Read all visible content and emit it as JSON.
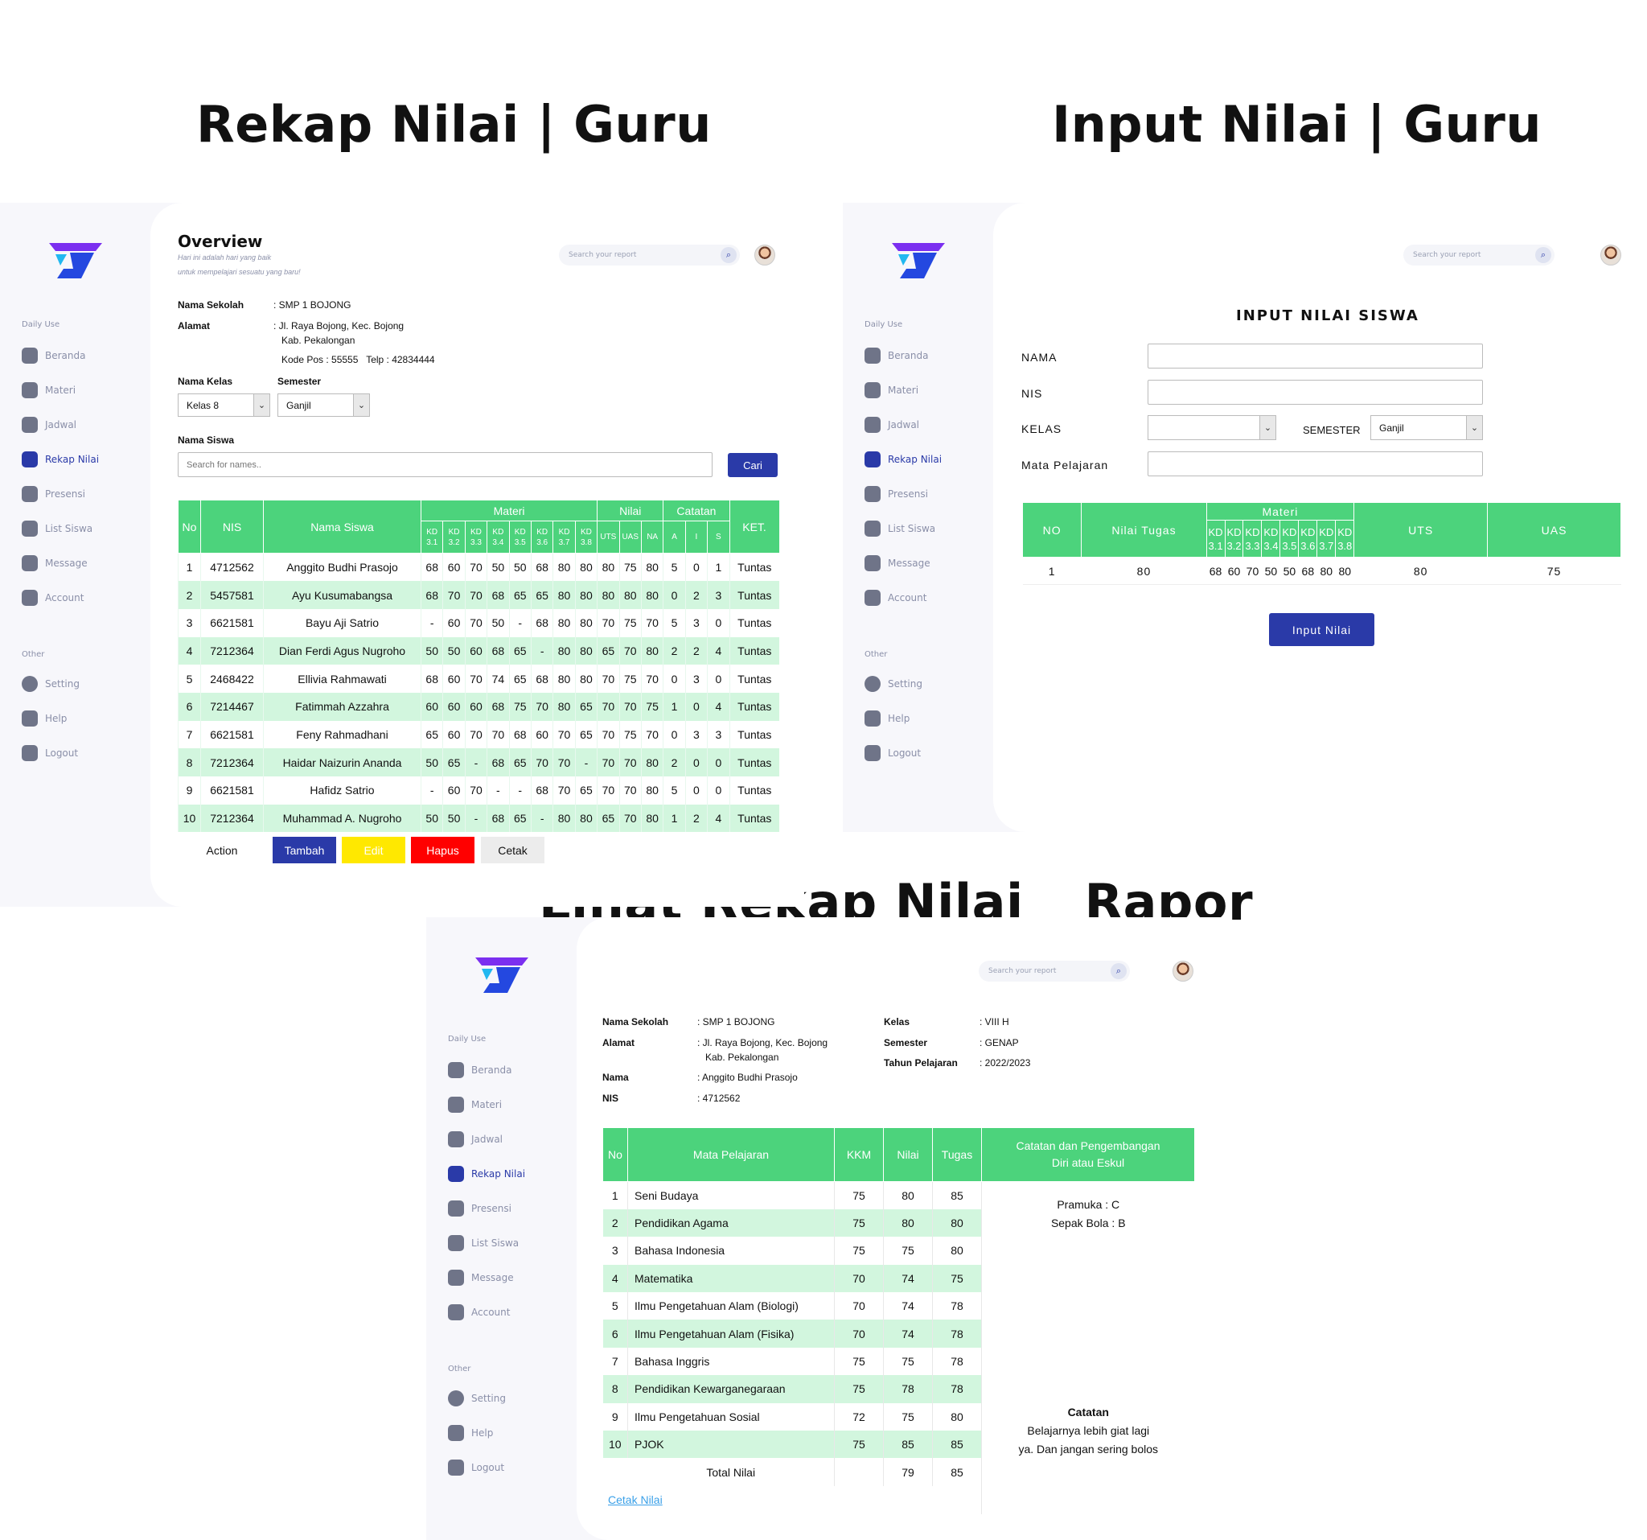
{
  "titles": {
    "rekap": "Rekap Nilai | Guru",
    "input": "Input Nilai | Guru",
    "rapor": "Lihat Rekap Nilai _ Rapor"
  },
  "sidebar": {
    "daily_label": "Daily Use",
    "other_label": "Other",
    "items": [
      "Beranda",
      "Materi",
      "Jadwal",
      "Rekap Nilai",
      "Presensi",
      "List Siswa",
      "Message",
      "Account"
    ],
    "other_items": [
      "Setting",
      "Help",
      "Logout"
    ],
    "active": "Rekap Nilai"
  },
  "search": {
    "placeholder": "Search your report"
  },
  "colors": {
    "green": "#4cd37c",
    "light_green": "#d2f6de",
    "blue": "#2a3aa8",
    "yellow": "#ffe800",
    "red": "#ff0000"
  },
  "rekap": {
    "overview": "Overview",
    "subtitle1": "Hari ini adalah hari yang baik",
    "subtitle2": "untuk mempelajari sesuatu yang baru!",
    "nama_sekolah_label": "Nama Sekolah",
    "nama_sekolah": ": SMP 1 BOJONG",
    "alamat_label": "Alamat",
    "alamat1": ": Jl. Raya Bojong, Kec. Bojong",
    "alamat2": "Kab. Pekalongan",
    "alamat3": "Kode Pos : 55555   Telp : 42834444",
    "nama_kelas_label": "Nama Kelas",
    "semester_label": "Semester",
    "kelas_value": "Kelas 8",
    "semester_value": "Ganjil",
    "nama_siswa_label": "Nama Siswa",
    "search_placeholder": "Search for names..",
    "cari": "Cari",
    "headers": {
      "no": "No",
      "nis": "NIS",
      "nama": "Nama Siswa",
      "materi": "Materi",
      "nilai": "Nilai",
      "catatan": "Catatan",
      "ket": "KET."
    },
    "kd": [
      "KD 3.1",
      "KD 3.2",
      "KD 3.3",
      "KD 3.4",
      "KD 3.5",
      "KD 3.6",
      "KD 3.7",
      "KD 3.8"
    ],
    "nilai_cols": [
      "UTS",
      "UAS",
      "NA"
    ],
    "catatan_cols": [
      "A",
      "I",
      "S"
    ],
    "rows": [
      [
        "1",
        "4712562",
        "Anggito Budhi Prasojo",
        "68",
        "60",
        "70",
        "50",
        "50",
        "68",
        "80",
        "80",
        "80",
        "75",
        "80",
        "5",
        "0",
        "1",
        "Tuntas"
      ],
      [
        "2",
        "5457581",
        "Ayu Kusumabangsa",
        "68",
        "70",
        "70",
        "68",
        "65",
        "65",
        "80",
        "80",
        "80",
        "80",
        "80",
        "0",
        "2",
        "3",
        "Tuntas"
      ],
      [
        "3",
        "6621581",
        "Bayu Aji Satrio",
        "-",
        "60",
        "70",
        "50",
        "-",
        "68",
        "80",
        "80",
        "70",
        "75",
        "70",
        "5",
        "3",
        "0",
        "Tuntas"
      ],
      [
        "4",
        "7212364",
        "Dian Ferdi Agus Nugroho",
        "50",
        "50",
        "60",
        "68",
        "65",
        "-",
        "80",
        "80",
        "65",
        "70",
        "80",
        "2",
        "2",
        "4",
        "Tuntas"
      ],
      [
        "5",
        "2468422",
        "Ellivia Rahmawati",
        "68",
        "60",
        "70",
        "74",
        "65",
        "68",
        "80",
        "80",
        "70",
        "75",
        "70",
        "0",
        "3",
        "0",
        "Tuntas"
      ],
      [
        "6",
        "7214467",
        "Fatimmah Azzahra",
        "60",
        "60",
        "60",
        "68",
        "75",
        "70",
        "80",
        "65",
        "70",
        "70",
        "75",
        "1",
        "0",
        "4",
        "Tuntas"
      ],
      [
        "7",
        "6621581",
        "Feny Rahmadhani",
        "65",
        "60",
        "70",
        "70",
        "68",
        "60",
        "70",
        "65",
        "70",
        "75",
        "70",
        "0",
        "3",
        "3",
        "Tuntas"
      ],
      [
        "8",
        "7212364",
        "Haidar Naizurin Ananda",
        "50",
        "65",
        "-",
        "68",
        "65",
        "70",
        "70",
        "-",
        "70",
        "70",
        "80",
        "2",
        "0",
        "0",
        "Tuntas"
      ],
      [
        "9",
        "6621581",
        "Hafidz Satrio",
        "-",
        "60",
        "70",
        "-",
        "-",
        "68",
        "70",
        "65",
        "70",
        "70",
        "80",
        "5",
        "0",
        "0",
        "Tuntas"
      ],
      [
        "10",
        "7212364",
        "Muhammad A. Nugroho",
        "50",
        "50",
        "-",
        "68",
        "65",
        "-",
        "80",
        "80",
        "65",
        "70",
        "80",
        "1",
        "2",
        "4",
        "Tuntas"
      ]
    ],
    "action": "Action",
    "tambah": "Tambah",
    "edit": "Edit",
    "hapus": "Hapus",
    "cetak": "Cetak"
  },
  "input": {
    "heading": "INPUT NILAI SISWA",
    "nama": "NAMA",
    "nis": "NIS",
    "kelas": "KELAS",
    "semester": "SEMESTER",
    "semester_value": "Ganjil",
    "mapel": "Mata Pelajaran",
    "headers": {
      "no": "NO",
      "tugas": "Nilai Tugas",
      "materi": "Materi",
      "uts": "UTS",
      "uas": "UAS"
    },
    "kd": [
      "KD 3.1",
      "KD 3.2",
      "KD 3.3",
      "KD 3.4",
      "KD 3.5",
      "KD 3.6",
      "KD 3.7",
      "KD 3.8"
    ],
    "row": {
      "no": "1",
      "tugas": "80",
      "kd": [
        "68",
        "60",
        "70",
        "50",
        "50",
        "68",
        "80",
        "80"
      ],
      "uts": "80",
      "uas": "75"
    },
    "button": "Input Nilai"
  },
  "rapor": {
    "nama_sekolah_label": "Nama Sekolah",
    "nama_sekolah": ": SMP 1 BOJONG",
    "alamat_label": "Alamat",
    "alamat1": ": Jl. Raya Bojong, Kec. Bojong",
    "alamat2": "Kab. Pekalongan",
    "nama_label": "Nama",
    "nama": ": Anggito Budhi Prasojo",
    "nis_label": "NIS",
    "nis": ": 4712562",
    "kelas_label": "Kelas",
    "kelas": ": VIII H",
    "semester_label": "Semester",
    "semester": ": GENAP",
    "tahun_label": "Tahun Pelajaran",
    "tahun": ": 2022/2023",
    "headers": {
      "no": "No",
      "mapel": "Mata Pelajaran",
      "kkm": "KKM",
      "nilai": "Nilai",
      "tugas": "Tugas",
      "catatan1": "Catatan dan Pengembangan",
      "catatan2": "Diri atau Eskul"
    },
    "rows": [
      [
        "1",
        "Seni Budaya",
        "75",
        "80",
        "85"
      ],
      [
        "2",
        "Pendidikan Agama",
        "75",
        "80",
        "80"
      ],
      [
        "3",
        "Bahasa Indonesia",
        "75",
        "75",
        "80"
      ],
      [
        "4",
        "Matematika",
        "70",
        "74",
        "75"
      ],
      [
        "5",
        "Ilmu Pengetahuan Alam (Biologi)",
        "70",
        "74",
        "78"
      ],
      [
        "6",
        "Ilmu Pengetahuan Alam (Fisika)",
        "70",
        "74",
        "78"
      ],
      [
        "7",
        "Bahasa Inggris",
        "75",
        "75",
        "78"
      ],
      [
        "8",
        "Pendidikan Kewarganegaraan",
        "75",
        "78",
        "78"
      ],
      [
        "9",
        "Ilmu Pengetahuan Sosial",
        "72",
        "75",
        "80"
      ],
      [
        "10",
        "PJOK",
        "75",
        "85",
        "85"
      ]
    ],
    "total_label": "Total Nilai",
    "total_nilai": "79",
    "total_tugas": "85",
    "eskul1": "Pramuka : C",
    "eskul2": "Sepak Bola : B",
    "catatan_title": "Catatan",
    "catatan1": "Belajarnya lebih giat lagi",
    "catatan2": "ya. Dan jangan sering bolos",
    "cetak": "Cetak Nilai"
  }
}
